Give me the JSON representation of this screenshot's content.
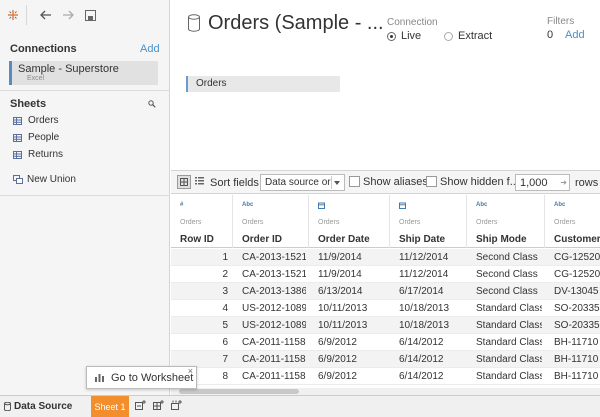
{
  "connections": {
    "title": "Connections",
    "add_label": "Add",
    "items": [
      {
        "name": "Sample - Superstore",
        "type": "Excel"
      }
    ]
  },
  "sheets": {
    "title": "Sheets",
    "items": [
      "Orders",
      "People",
      "Returns"
    ],
    "new_union": "New Union"
  },
  "header": {
    "title": "Orders (Sample - ...",
    "connection_label": "Connection",
    "live_label": "Live",
    "extract_label": "Extract",
    "connection_mode": "Live",
    "filters_label": "Filters",
    "filters_count": "0",
    "filters_add": "Add"
  },
  "canvas": {
    "table": "Orders"
  },
  "grid_toolbar": {
    "sort_label": "Sort fields",
    "sort_value": "Data source or",
    "show_aliases": "Show aliases",
    "show_hidden": "Show hidden f...",
    "rows_value": "1,000",
    "rows_label": "rows"
  },
  "grid": {
    "columns": [
      {
        "type": "#",
        "source": "Orders",
        "name": "Row ID"
      },
      {
        "type": "Abc",
        "source": "Orders",
        "name": "Order ID"
      },
      {
        "type": "date",
        "source": "Orders",
        "name": "Order Date"
      },
      {
        "type": "date",
        "source": "Orders",
        "name": "Ship Date"
      },
      {
        "type": "Abc",
        "source": "Orders",
        "name": "Ship Mode"
      },
      {
        "type": "Abc",
        "source": "Orders",
        "name": "Customer ID"
      }
    ],
    "rows": [
      [
        "1",
        "CA-2013-1521...",
        "11/9/2014",
        "11/12/2014",
        "Second Class",
        "CG-12520"
      ],
      [
        "2",
        "CA-2013-1521...",
        "11/9/2014",
        "11/12/2014",
        "Second Class",
        "CG-12520"
      ],
      [
        "3",
        "CA-2013-1386...",
        "6/13/2014",
        "6/17/2014",
        "Second Class",
        "DV-13045"
      ],
      [
        "4",
        "US-2012-1089...",
        "10/11/2013",
        "10/18/2013",
        "Standard Class",
        "SO-20335"
      ],
      [
        "5",
        "US-2012-1089...",
        "10/11/2013",
        "10/18/2013",
        "Standard Class",
        "SO-20335"
      ],
      [
        "6",
        "CA-2011-1158...",
        "6/9/2012",
        "6/14/2012",
        "Standard Class",
        "BH-11710"
      ],
      [
        "7",
        "CA-2011-1158...",
        "6/9/2012",
        "6/14/2012",
        "Standard Class",
        "BH-11710"
      ],
      [
        "8",
        "CA-2011-1158...",
        "6/9/2012",
        "6/14/2012",
        "Standard Class",
        "BH-11710"
      ]
    ]
  },
  "tooltip": {
    "text": "Go to Worksheet",
    "close": "×"
  },
  "bottom": {
    "data_source_tab": "Data Source",
    "sheet_tab": "Sheet 1"
  },
  "colors": {
    "accent": "#f28e2b",
    "link": "#4a90c8",
    "type_icon": "#4a79ad"
  }
}
